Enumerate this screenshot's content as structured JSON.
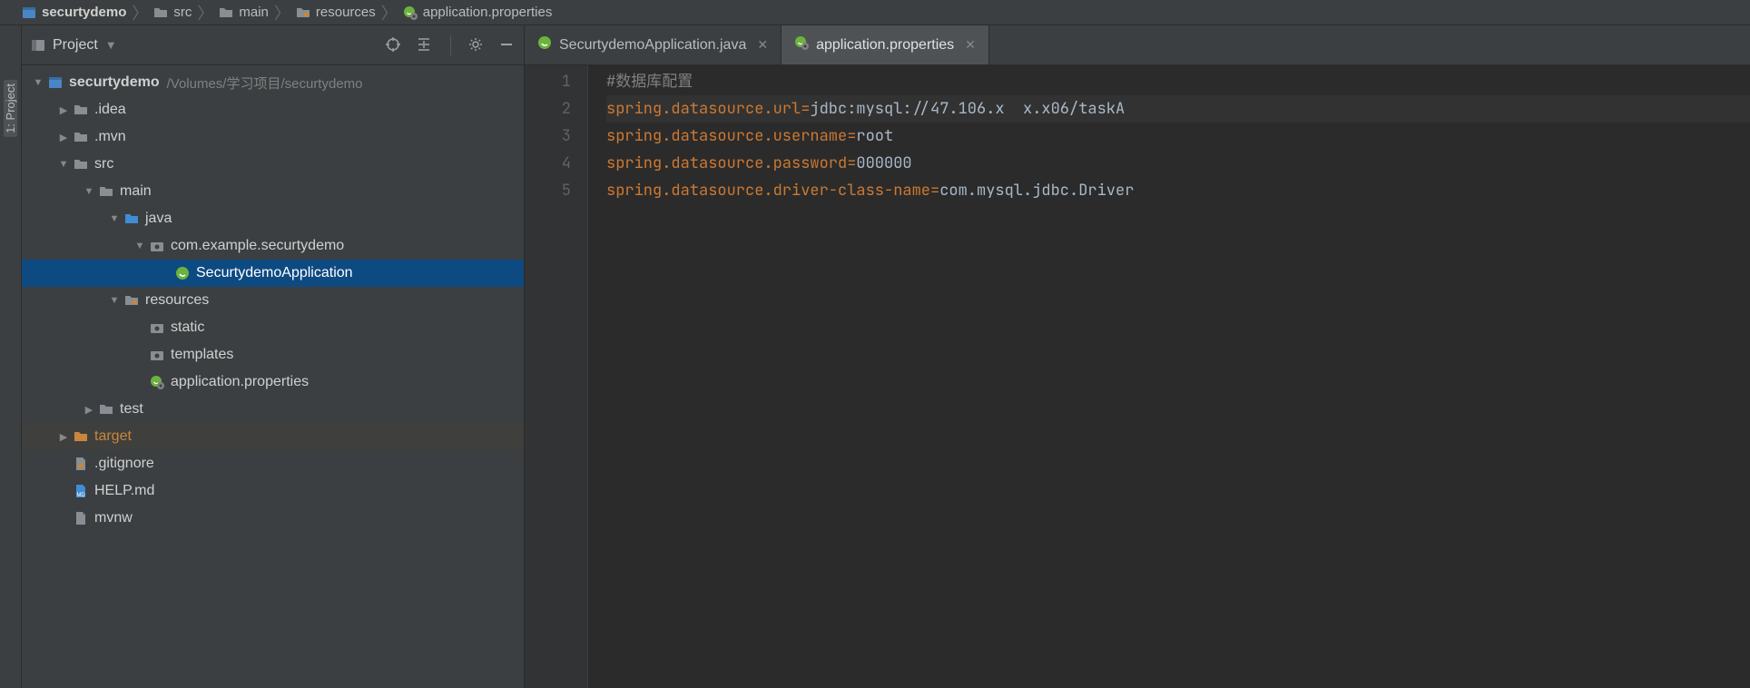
{
  "breadcrumb": [
    {
      "label": "securtydemo",
      "icon": "module"
    },
    {
      "label": "src",
      "icon": "folder"
    },
    {
      "label": "main",
      "icon": "folder"
    },
    {
      "label": "resources",
      "icon": "resources"
    },
    {
      "label": "application.properties",
      "icon": "spring-prop"
    }
  ],
  "sidebar_tool": {
    "label": "1: Project"
  },
  "project_panel": {
    "title": "Project",
    "tree": [
      {
        "depth": 0,
        "arrow": "down",
        "icon": "module",
        "name": "securtydemo",
        "hint": "/Volumes/学习项目/securtydemo",
        "bold": true
      },
      {
        "depth": 1,
        "arrow": "right",
        "icon": "folder-grey",
        "name": ".idea"
      },
      {
        "depth": 1,
        "arrow": "right",
        "icon": "folder-grey",
        "name": ".mvn"
      },
      {
        "depth": 1,
        "arrow": "down",
        "icon": "folder-grey",
        "name": "src"
      },
      {
        "depth": 2,
        "arrow": "down",
        "icon": "folder-grey",
        "name": "main"
      },
      {
        "depth": 3,
        "arrow": "down",
        "icon": "folder-blue",
        "name": "java"
      },
      {
        "depth": 4,
        "arrow": "down",
        "icon": "package",
        "name": "com.example.securtydemo"
      },
      {
        "depth": 5,
        "arrow": "",
        "icon": "spring-class",
        "name": "SecurtydemoApplication",
        "selected": true
      },
      {
        "depth": 3,
        "arrow": "down",
        "icon": "resources",
        "name": "resources"
      },
      {
        "depth": 4,
        "arrow": "",
        "icon": "package",
        "name": "static"
      },
      {
        "depth": 4,
        "arrow": "",
        "icon": "package",
        "name": "templates"
      },
      {
        "depth": 4,
        "arrow": "",
        "icon": "spring-prop",
        "name": "application.properties"
      },
      {
        "depth": 2,
        "arrow": "right",
        "icon": "folder-grey",
        "name": "test"
      },
      {
        "depth": 1,
        "arrow": "right",
        "icon": "folder-orange",
        "name": "target",
        "target": true
      },
      {
        "depth": 1,
        "arrow": "",
        "icon": "gitignore",
        "name": ".gitignore"
      },
      {
        "depth": 1,
        "arrow": "",
        "icon": "md",
        "name": "HELP.md"
      },
      {
        "depth": 1,
        "arrow": "",
        "icon": "file",
        "name": "mvnw"
      }
    ]
  },
  "editor": {
    "tabs": [
      {
        "label": "SecurtydemoApplication.java",
        "icon": "spring-class",
        "active": false
      },
      {
        "label": "application.properties",
        "icon": "spring-prop",
        "active": true
      }
    ],
    "lines": [
      {
        "n": "1",
        "type": "comment",
        "text": "#数据库配置"
      },
      {
        "n": "2",
        "type": "kv",
        "key": "spring.datasource.url",
        "val": "jdbc:mysql://47.106.x  x.x06/taskA",
        "hl": true
      },
      {
        "n": "3",
        "type": "kv",
        "key": "spring.datasource.username",
        "val": "root"
      },
      {
        "n": "4",
        "type": "kv",
        "key": "spring.datasource.password",
        "val": "000000"
      },
      {
        "n": "5",
        "type": "kv",
        "key": "spring.datasource.driver-class-name",
        "val": "com.mysql.jdbc.Driver"
      }
    ]
  }
}
